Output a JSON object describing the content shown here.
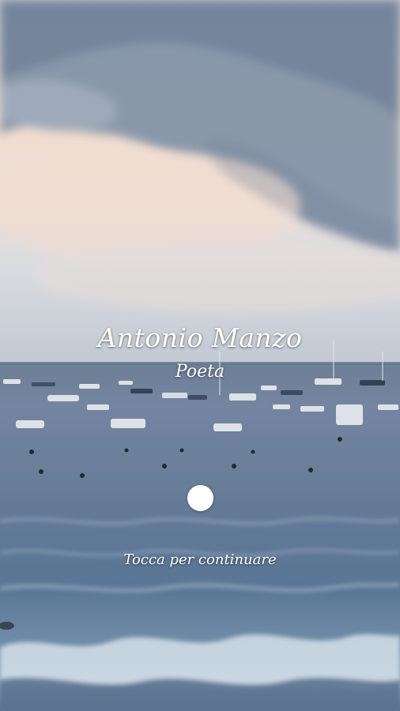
{
  "screen": {
    "title": "Antonio Manzo",
    "subtitle": "Poeta",
    "tap_hint": "Tocca per continuare"
  },
  "background": {
    "description_icon": "sea-photo",
    "sky_color": "#eadcd2",
    "cloud_color": "#7c8ea4",
    "sea_color": "#627b98",
    "foam_color": "#c9d6e2"
  },
  "colors": {
    "text": "#ffffff",
    "dot": "#ffffff"
  }
}
